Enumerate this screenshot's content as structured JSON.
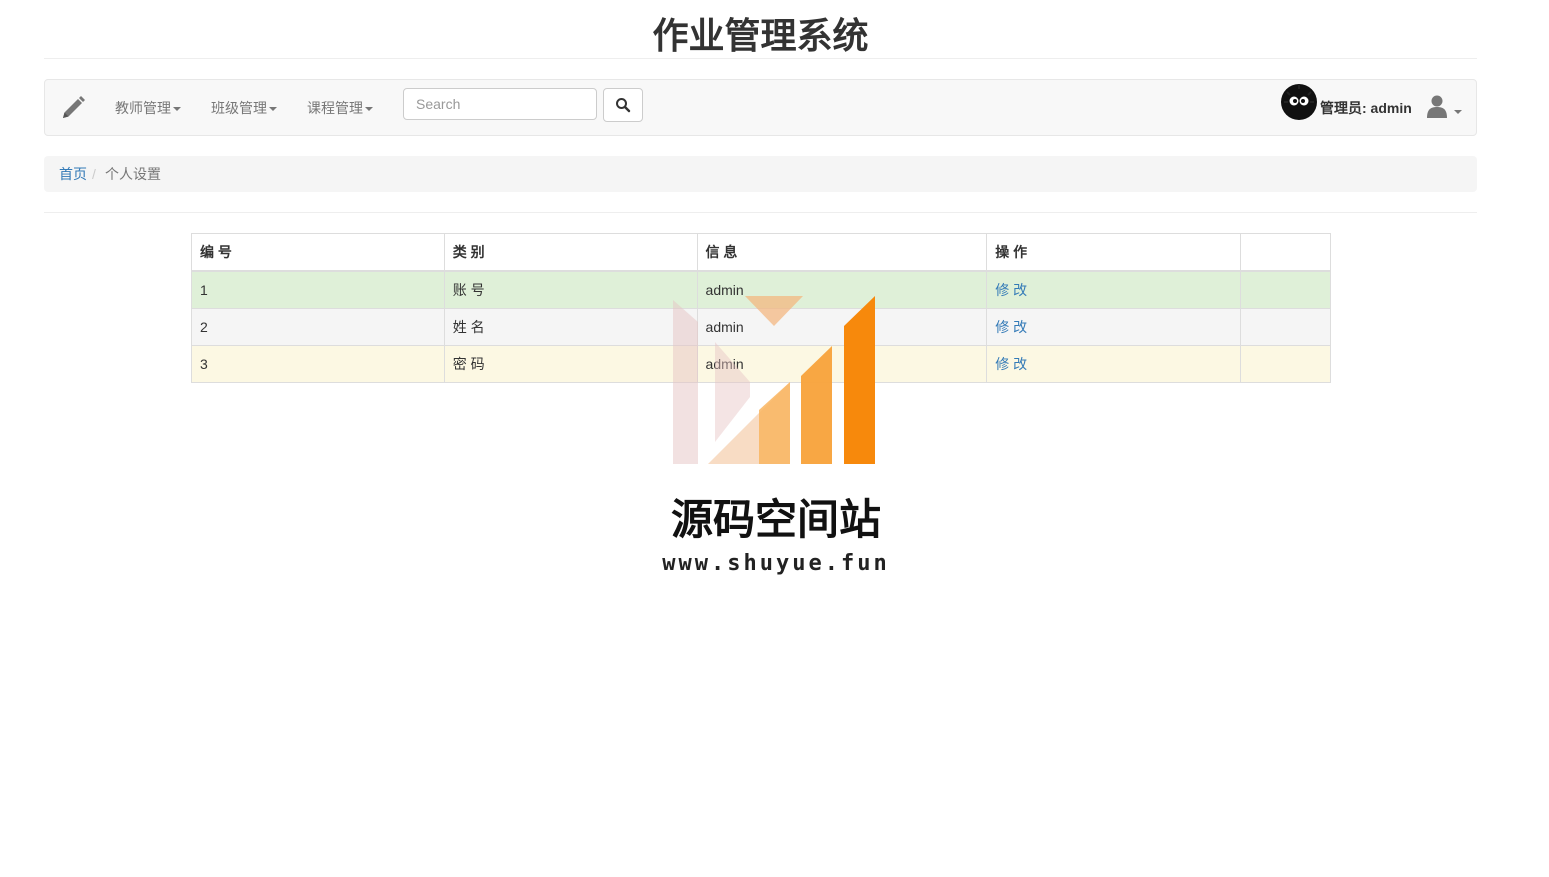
{
  "header": {
    "title": "作业管理系统"
  },
  "navbar": {
    "brand_icon": "pencil-icon",
    "menus": [
      {
        "label": "教师管理"
      },
      {
        "label": "班级管理"
      },
      {
        "label": "课程管理"
      }
    ],
    "search": {
      "placeholder": "Search",
      "value": "",
      "button_icon": "search-icon"
    },
    "user": {
      "label": "管理员: admin",
      "menu_icon": "user-icon"
    }
  },
  "breadcrumb": {
    "home": "首页",
    "separator": "/",
    "current": "个人设置"
  },
  "table": {
    "columns": [
      "编 号",
      "类 别",
      "信 息",
      "操 作",
      ""
    ],
    "rows": [
      {
        "id": "1",
        "category": "账 号",
        "info": "admin",
        "action": "修 改"
      },
      {
        "id": "2",
        "category": "姓 名",
        "info": "admin",
        "action": "修 改"
      },
      {
        "id": "3",
        "category": "密 码",
        "info": "admin",
        "action": "修 改"
      }
    ]
  },
  "watermark": {
    "text": "源码空间站",
    "url": "www.shuyue.fun"
  },
  "colors": {
    "link": "#337ab7",
    "row_success": "#dff0d8",
    "row_active": "#f5f5f5",
    "row_warning": "#fcf8e3",
    "navbar_bg": "#f8f8f8",
    "watermark_orange": "#f7890c"
  }
}
